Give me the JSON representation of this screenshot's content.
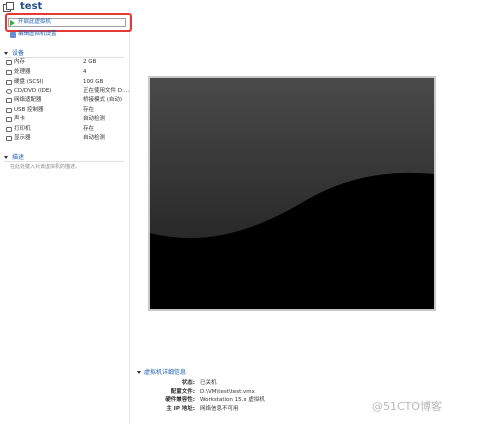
{
  "header": {
    "title": "test",
    "icon": "vm-icon"
  },
  "actions": {
    "start_label": "开启此虚拟机",
    "edit_label": "编辑虚拟机设置"
  },
  "devices": {
    "section_label": "设备",
    "items": [
      {
        "name": "内存",
        "value": "2 GB",
        "icon": "memory-icon"
      },
      {
        "name": "处理器",
        "value": "4",
        "icon": "cpu-icon"
      },
      {
        "name": "硬盘 (SCSI)",
        "value": "100 GB",
        "icon": "hard-disk-icon"
      },
      {
        "name": "CD/DVD (IDE)",
        "value": "正在使用文件 D:...",
        "icon": "cd-dvd-icon"
      },
      {
        "name": "网络适配器",
        "value": "桥接模式 (自动)",
        "icon": "network-adapter-icon"
      },
      {
        "name": "USB 控制器",
        "value": "存在",
        "icon": "usb-icon"
      },
      {
        "name": "声卡",
        "value": "自动检测",
        "icon": "sound-card-icon"
      },
      {
        "name": "打印机",
        "value": "存在",
        "icon": "printer-icon"
      },
      {
        "name": "显示器",
        "value": "自动检测",
        "icon": "display-icon"
      }
    ]
  },
  "description": {
    "section_label": "描述",
    "placeholder": "在此处键入对该虚拟机的描述。"
  },
  "details": {
    "section_label": "虚拟机详细信息",
    "rows": [
      {
        "key": "状态:",
        "value": "已关机"
      },
      {
        "key": "配置文件:",
        "value": "D:\\VM\\test\\test.vmx"
      },
      {
        "key": "硬件兼容性:",
        "value": "Workstation 15.x 虚拟机"
      },
      {
        "key": "主 IP 地址:",
        "value": "网络信息不可用"
      }
    ]
  },
  "watermark": "@51CTO博客",
  "colors": {
    "highlight": "#e53935",
    "link": "#1a5fb4",
    "play": "#3aa93a"
  }
}
